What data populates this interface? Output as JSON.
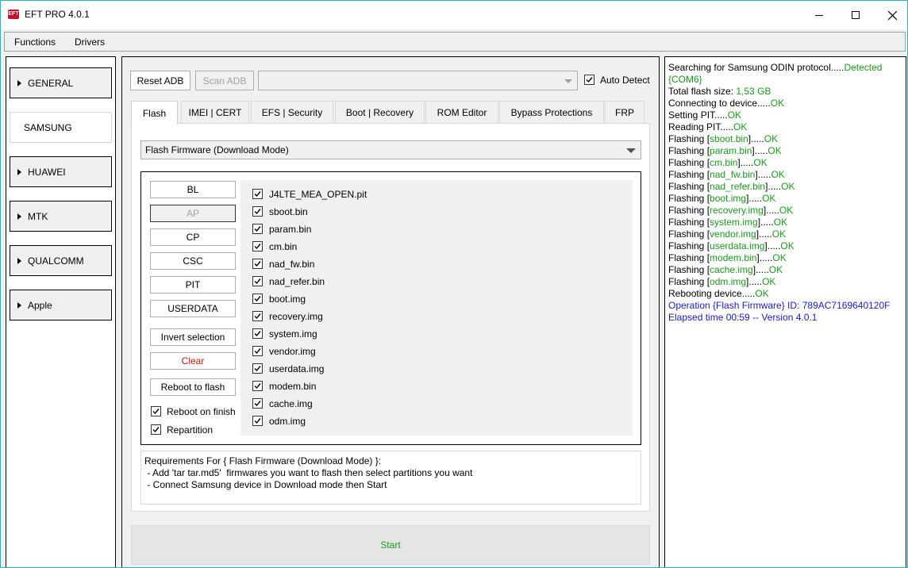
{
  "window": {
    "title": "EFT PRO 4.0.1",
    "icon_label": "EFT",
    "accent_border": "#1fb6c6"
  },
  "menu": [
    "Functions",
    "Drivers"
  ],
  "sidebar": {
    "items": [
      {
        "label": "GENERAL",
        "active": false
      },
      {
        "label": "SAMSUNG",
        "active": true
      },
      {
        "label": "HUAWEI",
        "active": false
      },
      {
        "label": "MTK",
        "active": false
      },
      {
        "label": "QUALCOMM",
        "active": false
      },
      {
        "label": "Apple",
        "active": false
      }
    ]
  },
  "adb": {
    "reset_label": "Reset ADB",
    "scan_label": "Scan ADB",
    "device_value": "",
    "auto_detect_label": "Auto Detect",
    "auto_detect_checked": true
  },
  "tabs": [
    {
      "label": "Flash",
      "active": true
    },
    {
      "label": "IMEI | CERT",
      "active": false
    },
    {
      "label": "EFS | Security",
      "active": false
    },
    {
      "label": "Boot | Recovery",
      "active": false
    },
    {
      "label": "ROM Editor",
      "active": false
    },
    {
      "label": "Bypass Protections",
      "active": false
    },
    {
      "label": "FRP",
      "active": false
    }
  ],
  "flash": {
    "mode_value": "Flash Firmware (Download Mode)",
    "file_buttons": [
      {
        "label": "BL",
        "disabled": false
      },
      {
        "label": "AP",
        "disabled": true
      },
      {
        "label": "CP",
        "disabled": false
      },
      {
        "label": "CSC",
        "disabled": false
      },
      {
        "label": "PIT",
        "disabled": false
      },
      {
        "label": "USERDATA",
        "disabled": false
      }
    ],
    "invert_label": "Invert selection",
    "clear_label": "Clear",
    "clear_color": "#d01010",
    "reboot_to_flash_label": "Reboot to flash",
    "reboot_on_finish_label": "Reboot on finish",
    "reboot_on_finish_checked": true,
    "repartition_label": "Repartition",
    "repartition_checked": true,
    "files": [
      "J4LTE_MEA_OPEN.pit",
      "sboot.bin",
      "param.bin",
      "cm.bin",
      "nad_fw.bin",
      "nad_refer.bin",
      "boot.img",
      "recovery.img",
      "system.img",
      "vendor.img",
      "userdata.img",
      "modem.bin",
      "cache.img",
      "odm.img"
    ],
    "requirements": [
      "Requirements For { Flash Firmware (Download Mode) }:",
      " - Add 'tar tar.md5'  firmwares you want to flash then select partitions you want",
      " - Connect Samsung device in Download mode then Start"
    ],
    "start_label": "Start",
    "start_color": "#1a9a1a"
  },
  "log": {
    "colors": {
      "ok": "#1a9a1a",
      "info": "#1a1ad0"
    },
    "lines": [
      [
        {
          "t": "Searching for Samsung ODIN protocol.....",
          "c": ""
        },
        {
          "t": "Detected",
          "c": "g"
        }
      ],
      [
        {
          "t": "{COM6}",
          "c": "g"
        }
      ],
      [
        {
          "t": "Total flash size: ",
          "c": ""
        },
        {
          "t": "1,53 GB",
          "c": "g"
        }
      ],
      [
        {
          "t": "Connecting to device.....",
          "c": ""
        },
        {
          "t": "OK",
          "c": "g"
        }
      ],
      [
        {
          "t": "Setting PIT.....",
          "c": ""
        },
        {
          "t": "OK",
          "c": "g"
        }
      ],
      [
        {
          "t": "Reading PIT.....",
          "c": ""
        },
        {
          "t": "OK",
          "c": "g"
        }
      ],
      [
        {
          "t": "Flashing [",
          "c": ""
        },
        {
          "t": "sboot.bin",
          "c": "g"
        },
        {
          "t": "].....",
          "c": ""
        },
        {
          "t": "OK",
          "c": "g"
        }
      ],
      [
        {
          "t": "Flashing [",
          "c": ""
        },
        {
          "t": "param.bin",
          "c": "g"
        },
        {
          "t": "].....",
          "c": ""
        },
        {
          "t": "OK",
          "c": "g"
        }
      ],
      [
        {
          "t": "Flashing [",
          "c": ""
        },
        {
          "t": "cm.bin",
          "c": "g"
        },
        {
          "t": "].....",
          "c": ""
        },
        {
          "t": "OK",
          "c": "g"
        }
      ],
      [
        {
          "t": "Flashing [",
          "c": ""
        },
        {
          "t": "nad_fw.bin",
          "c": "g"
        },
        {
          "t": "].....",
          "c": ""
        },
        {
          "t": "OK",
          "c": "g"
        }
      ],
      [
        {
          "t": "Flashing [",
          "c": ""
        },
        {
          "t": "nad_refer.bin",
          "c": "g"
        },
        {
          "t": "].....",
          "c": ""
        },
        {
          "t": "OK",
          "c": "g"
        }
      ],
      [
        {
          "t": "Flashing [",
          "c": ""
        },
        {
          "t": "boot.img",
          "c": "g"
        },
        {
          "t": "].....",
          "c": ""
        },
        {
          "t": "OK",
          "c": "g"
        }
      ],
      [
        {
          "t": "Flashing [",
          "c": ""
        },
        {
          "t": "recovery.img",
          "c": "g"
        },
        {
          "t": "].....",
          "c": ""
        },
        {
          "t": "OK",
          "c": "g"
        }
      ],
      [
        {
          "t": "Flashing [",
          "c": ""
        },
        {
          "t": "system.img",
          "c": "g"
        },
        {
          "t": "].....",
          "c": ""
        },
        {
          "t": "OK",
          "c": "g"
        }
      ],
      [
        {
          "t": "Flashing [",
          "c": ""
        },
        {
          "t": "vendor.img",
          "c": "g"
        },
        {
          "t": "].....",
          "c": ""
        },
        {
          "t": "OK",
          "c": "g"
        }
      ],
      [
        {
          "t": "Flashing [",
          "c": ""
        },
        {
          "t": "userdata.img",
          "c": "g"
        },
        {
          "t": "].....",
          "c": ""
        },
        {
          "t": "OK",
          "c": "g"
        }
      ],
      [
        {
          "t": "Flashing [",
          "c": ""
        },
        {
          "t": "modem.bin",
          "c": "g"
        },
        {
          "t": "].....",
          "c": ""
        },
        {
          "t": "OK",
          "c": "g"
        }
      ],
      [
        {
          "t": "Flashing [",
          "c": ""
        },
        {
          "t": "cache.img",
          "c": "g"
        },
        {
          "t": "].....",
          "c": ""
        },
        {
          "t": "OK",
          "c": "g"
        }
      ],
      [
        {
          "t": "Flashing [",
          "c": ""
        },
        {
          "t": "odm.img",
          "c": "g"
        },
        {
          "t": "].....",
          "c": ""
        },
        {
          "t": "OK",
          "c": "g"
        }
      ],
      [
        {
          "t": "Rebooting device.....",
          "c": ""
        },
        {
          "t": "OK",
          "c": "g"
        }
      ],
      [
        {
          "t": "Operation {Flash Firmware} ID: 789AC7169640120F",
          "c": "b"
        }
      ],
      [
        {
          "t": "Elapsed time 00:59 -- Version 4.0.1",
          "c": "b"
        }
      ]
    ]
  }
}
